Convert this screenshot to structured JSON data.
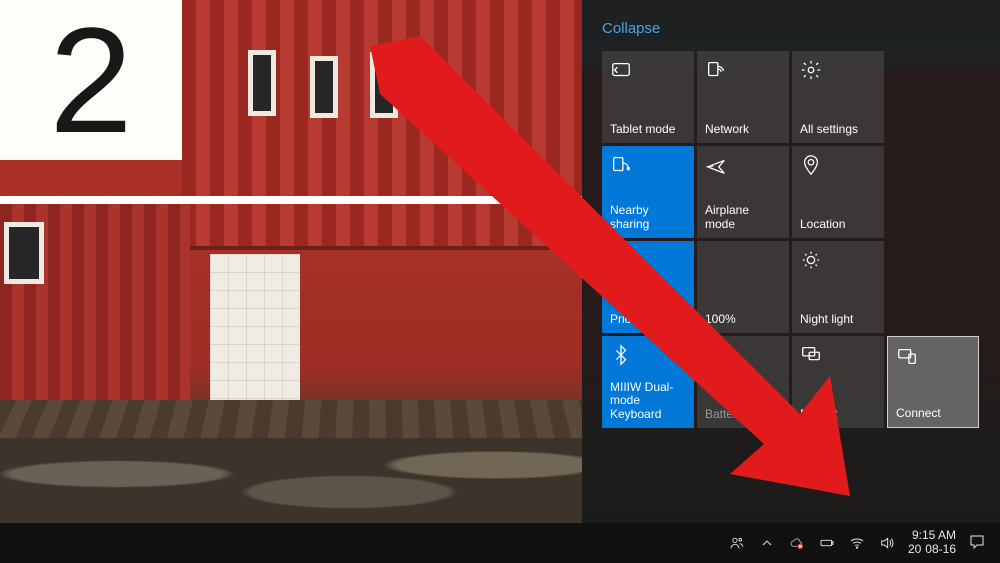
{
  "step_number": "2",
  "action_center": {
    "collapse_label": "Collapse",
    "tiles": [
      {
        "id": "tablet-mode",
        "label": "Tablet mode",
        "icon": "tablet-icon",
        "active": false
      },
      {
        "id": "network",
        "label": "Network",
        "icon": "wifi-icon",
        "active": false
      },
      {
        "id": "all-settings",
        "label": "All settings",
        "icon": "gear-icon",
        "active": false
      },
      {
        "id": "nearby-sharing",
        "label": "Nearby sharing",
        "icon": "share-icon",
        "active": true
      },
      {
        "id": "airplane-mode",
        "label": "Airplane mode",
        "icon": "airplane-icon",
        "active": false
      },
      {
        "id": "location",
        "label": "Location",
        "icon": "location-icon",
        "active": false
      },
      {
        "id": "priority-only",
        "label": "Priority only",
        "icon": "moon-icon",
        "active": true
      },
      {
        "id": "brightness",
        "label": "100%",
        "icon": "sun-icon",
        "active": false,
        "obscured": true
      },
      {
        "id": "night-light",
        "label": "Night light",
        "icon": "brightness-icon",
        "active": false
      },
      {
        "id": "bluetooth",
        "label": "MIIIW Dual-mode Keyboard",
        "icon": "bluetooth-icon",
        "active": true
      },
      {
        "id": "battery-saver",
        "label": "Battery saver",
        "icon": "leaf-icon",
        "active": false,
        "dim": true
      },
      {
        "id": "project",
        "label": "Project",
        "icon": "project-icon",
        "active": false
      },
      {
        "id": "connect",
        "label": "Connect",
        "icon": "connect-icon",
        "active": false,
        "highlight": true
      }
    ]
  },
  "taskbar": {
    "time": "9:15 AM",
    "year_prefix": "20",
    "date": "08-16"
  }
}
